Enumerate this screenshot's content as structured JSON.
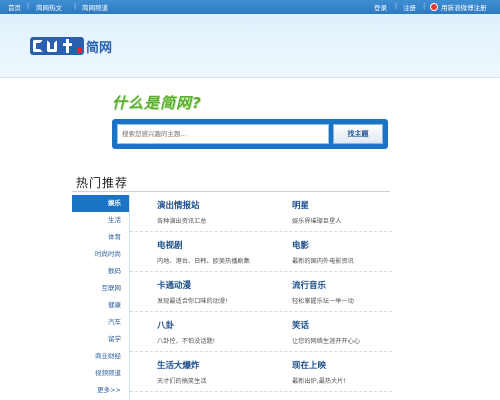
{
  "topbar": {
    "home": "首页",
    "about": "简网热文",
    "nav": "简网频道",
    "login": "登录",
    "register": "注册",
    "weibo": "用新浪微博注册"
  },
  "logo": {
    "text": "简网"
  },
  "slogan": "什么是简网?",
  "search": {
    "placeholder": "搜索您感兴趣的主题...",
    "button": "找主题"
  },
  "section": {
    "title": "热门推荐"
  },
  "categories": [
    "娱乐",
    "生活",
    "体育",
    "时尚时尚",
    "数码",
    "互联网",
    "健康",
    "汽车",
    "留学",
    "商业财经",
    "视频频道",
    "更多>>"
  ],
  "items": [
    [
      {
        "title": "演出情报站",
        "desc": "各种演出资讯汇总"
      },
      {
        "title": "明星",
        "desc": "娱乐界璀璨巨星人"
      }
    ],
    [
      {
        "title": "电视剧",
        "desc": "内地、港台、日韩、欧美热播剧集"
      },
      {
        "title": "电影",
        "desc": "最新的国内外电影资讯"
      }
    ],
    [
      {
        "title": "卡通动漫",
        "desc": "发现最适合你口味的动漫!"
      },
      {
        "title": "流行音乐",
        "desc": "轻松掌握乐坛一举一动"
      }
    ],
    [
      {
        "title": "八卦",
        "desc": "八卦控，不怕没话题!"
      },
      {
        "title": "笑话",
        "desc": "让您的网络生涯开开心心"
      }
    ],
    [
      {
        "title": "生活大爆炸",
        "desc": "天才们的搞笑生活"
      },
      {
        "title": "现在上映",
        "desc": "最新出炉,最热大片!"
      }
    ]
  ]
}
